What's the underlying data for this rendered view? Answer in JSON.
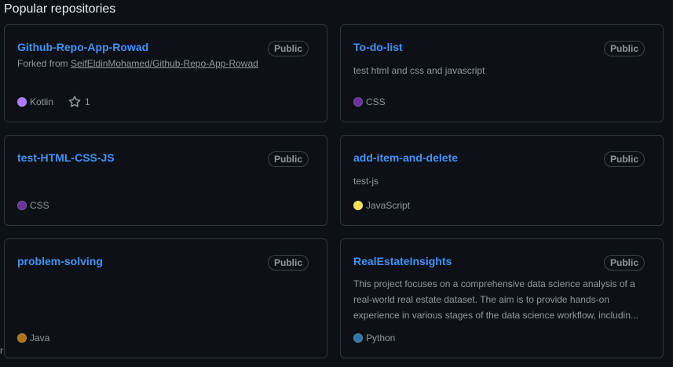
{
  "section_title": "Popular repositories",
  "repos": [
    {
      "name": "Github-Repo-App-Rowad",
      "visibility": "Public",
      "forked_prefix": "Forked from ",
      "forked_from": "SeifEldinMohamed/Github-Repo-App-Rowad",
      "description": "",
      "language": "Kotlin",
      "language_color": "#A97BFF",
      "stars": "1"
    },
    {
      "name": "To-do-list",
      "visibility": "Public",
      "description": "test html and css and javascript",
      "language": "CSS",
      "language_color": "#663399"
    },
    {
      "name": "test-HTML-CSS-JS",
      "visibility": "Public",
      "description": "",
      "language": "CSS",
      "language_color": "#663399"
    },
    {
      "name": "add-item-and-delete",
      "visibility": "Public",
      "description": "test-js",
      "language": "JavaScript",
      "language_color": "#F1E05A"
    },
    {
      "name": "problem-solving",
      "visibility": "Public",
      "description": "",
      "language": "Java",
      "language_color": "#B07219"
    },
    {
      "name": "RealEstateInsights",
      "visibility": "Public",
      "description": "This project focuses on a comprehensive data science analysis of a real-world real estate dataset. The aim is to provide hands-on experience in various stages of the data science workflow, includin...",
      "language": "Python",
      "language_color": "#3572A5"
    }
  ]
}
